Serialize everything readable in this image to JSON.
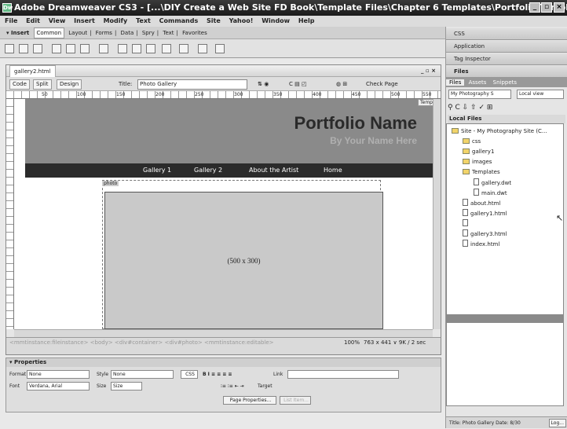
{
  "window": {
    "title": "Adobe Dreamweaver CS3 - [...\\DIY Create a Web Site FD Book\\Template Files\\Chapter 6 Templates\\Portfolio Template Sit..."
  },
  "menu": [
    "File",
    "Edit",
    "View",
    "Insert",
    "Modify",
    "Text",
    "Commands",
    "Site",
    "Yahoo!",
    "Window",
    "Help"
  ],
  "insert_bar": {
    "label": "▾ Insert",
    "tabs": [
      "Common",
      "Layout",
      "Forms",
      "Data",
      "Spry",
      "Text",
      "Favorites"
    ]
  },
  "document": {
    "tab": "gallery2.html",
    "view_buttons": [
      "Code",
      "Split",
      "Design"
    ],
    "title_label": "Title:",
    "title_value": "Photo Gallery",
    "check_page": "Check Page",
    "ruler_ticks": [
      "50",
      "100",
      "150",
      "200",
      "250",
      "300",
      "350",
      "400",
      "450",
      "500",
      "550",
      "600",
      "650",
      "700",
      "750"
    ],
    "template_tag": "Temp"
  },
  "page": {
    "brand": "Portfolio Name",
    "tagline": "By Your Name Here",
    "nav": [
      "Gallery 1",
      "Gallery 2",
      "About the Artist",
      "Home"
    ],
    "editable_tag": "photo",
    "placeholder": "(500 x 300)"
  },
  "status": {
    "tag_path": "<mmtinstance:fileinstance> <body> <div#container> <div#photo> <mmtinstance:editable>",
    "zoom": "100%",
    "size": "763 x 441 ∨ 9K / 2 sec"
  },
  "properties": {
    "title": "▾ Properties",
    "format_label": "Format",
    "format_value": "None",
    "style_label": "Style",
    "style_value": "None",
    "css_btn": "CSS",
    "font_label": "Font",
    "font_value": "Verdana, Arial",
    "size_label": "Size",
    "size_value": "Size",
    "link_label": "Link",
    "target_label": "Target",
    "page_props_btn": "Page Properties...",
    "list_item_btn": "List Item..."
  },
  "panels": {
    "groups": [
      "CSS",
      "Application",
      "Tag Inspector",
      "Files"
    ],
    "files_tabs": [
      "Files",
      "Assets",
      "Snippets"
    ],
    "site_select": "My Photography S",
    "view_select": "Local view",
    "local_files": "Local Files",
    "tree": [
      {
        "name": "Site - My Photography Site (C...",
        "kind": "folder",
        "level": 0
      },
      {
        "name": "css",
        "kind": "folder",
        "level": 1
      },
      {
        "name": "gallery1",
        "kind": "folder",
        "level": 1
      },
      {
        "name": "images",
        "kind": "folder",
        "level": 1
      },
      {
        "name": "Templates",
        "kind": "folder",
        "level": 1
      },
      {
        "name": "gallery.dwt",
        "kind": "file",
        "level": 2
      },
      {
        "name": "main.dwt",
        "kind": "file",
        "level": 2
      },
      {
        "name": "about.html",
        "kind": "file",
        "level": 1
      },
      {
        "name": "gallery1.html",
        "kind": "file",
        "level": 1
      },
      {
        "name": "gallery2.html",
        "kind": "file",
        "level": 1
      },
      {
        "name": "gallery3.html",
        "kind": "file",
        "level": 1
      },
      {
        "name": "index.html",
        "kind": "file",
        "level": 1
      }
    ],
    "selected_file": "gallery2.html",
    "bottom_status": "Title: Photo Gallery Date: 8/30",
    "log_btn": "Log..."
  }
}
